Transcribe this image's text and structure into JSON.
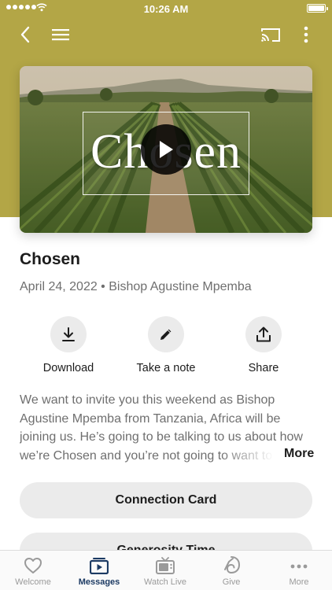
{
  "status_bar": {
    "time": "10:26 AM"
  },
  "nav": {
    "back_icon": "chevron-left-icon",
    "menu_icon": "hamburger-icon",
    "cast_icon": "cast-icon",
    "overflow_icon": "vertical-ellipsis-icon"
  },
  "video": {
    "overlay_title": "Chosen",
    "play_icon": "play-icon"
  },
  "message": {
    "title": "Chosen",
    "meta": "April 24, 2022 • Bishop Agustine Mpemba"
  },
  "actions": [
    {
      "label": "Download",
      "icon": "download-icon"
    },
    {
      "label": "Take a note",
      "icon": "pencil-icon"
    },
    {
      "label": "Share",
      "icon": "share-icon"
    }
  ],
  "description": {
    "text": "We want to invite you this weekend as Bishop Agustine Mpemba from Tanzania, Africa will be joining us. He’s going to be talking to us about how we’re Chosen and you’re not going to want to miss it.",
    "more_label": "More"
  },
  "buttons": {
    "connection_card": "Connection Card",
    "generosity_time": "Generosity Time"
  },
  "tabs": [
    {
      "label": "Welcome",
      "icon": "heart-icon",
      "active": false
    },
    {
      "label": "Messages",
      "icon": "video-list-icon",
      "active": true
    },
    {
      "label": "Watch Live",
      "icon": "tv-icon",
      "active": false
    },
    {
      "label": "Give",
      "icon": "give-icon",
      "active": false
    },
    {
      "label": "More",
      "icon": "more-dots-icon",
      "active": false
    }
  ],
  "colors": {
    "header": "#b3a646",
    "active_tab": "#1c3a63",
    "inactive_tab": "#9a9a9a",
    "button_bg": "#ebebeb"
  }
}
